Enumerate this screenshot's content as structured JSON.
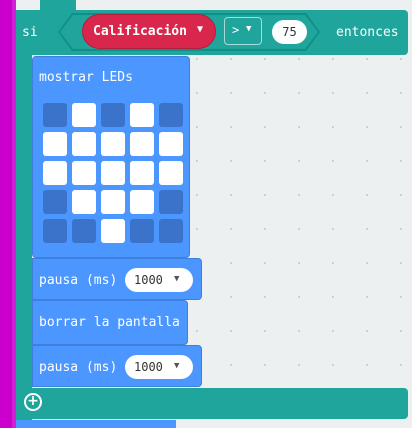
{
  "if_block": {
    "keyword_if": "si",
    "keyword_then": "entonces",
    "variable": "Calificación",
    "variable_caret": "▼",
    "operator": ">",
    "operator_caret": "▼",
    "compare_value": "75",
    "add_icon": "plus-circle-icon",
    "add_glyph": "+"
  },
  "show_leds": {
    "label": "mostrar LEDs",
    "leds": [
      [
        0,
        1,
        0,
        1,
        0
      ],
      [
        1,
        1,
        1,
        1,
        1
      ],
      [
        1,
        1,
        1,
        1,
        1
      ],
      [
        0,
        1,
        1,
        1,
        0
      ],
      [
        0,
        0,
        1,
        0,
        0
      ]
    ]
  },
  "pause1": {
    "label": "pausa (ms)",
    "value": "1000",
    "caret": "▼"
  },
  "clear_screen": {
    "label": "borrar la pantalla"
  },
  "pause2": {
    "label": "pausa (ms)",
    "value": "1000",
    "caret": "▼"
  },
  "colors": {
    "logic": "#1fa59b",
    "variable": "#d9264c",
    "basic": "#4c97ff",
    "rail": "#cc00cc",
    "led_on": "#ffffff",
    "led_off": "#3a73c9"
  }
}
